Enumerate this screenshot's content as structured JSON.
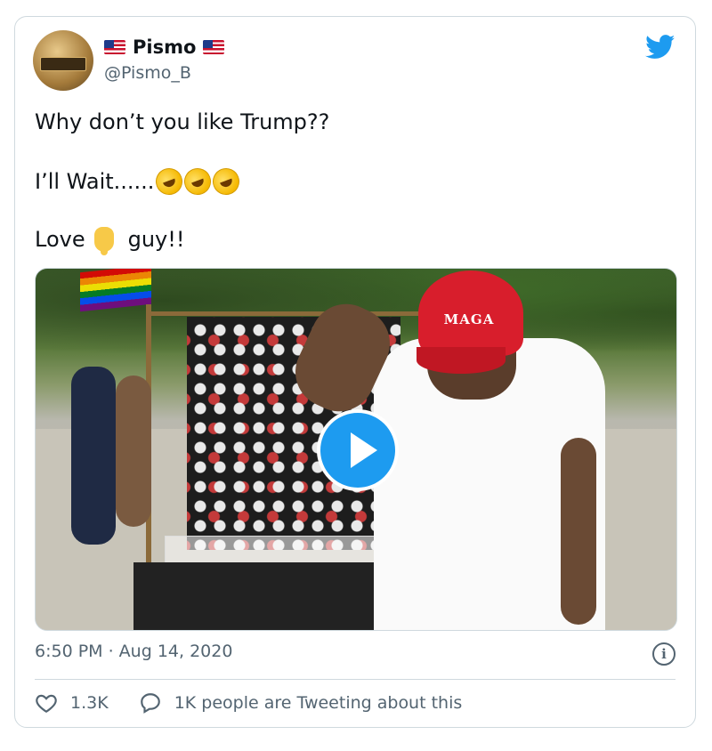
{
  "author": {
    "display_name": "Pismo",
    "handle": "@Pismo_B",
    "avatar_icon": "avatar-trump-plaque",
    "flag_icon": "us-flag-emoji"
  },
  "tweet": {
    "line1": "Why don’t you like Trump??",
    "line2": "I’ll Wait......",
    "line2_emojis": [
      "rolling-on-floor-laughing-emoji",
      "rolling-on-floor-laughing-emoji",
      "rolling-on-floor-laughing-emoji"
    ],
    "line3_start": "Love",
    "line3_emoji": "pointing-down-emoji",
    "line3_end": "guy!!"
  },
  "media": {
    "type": "video",
    "hat_text": "MAGA",
    "play_icon": "play-icon"
  },
  "meta": {
    "timestamp": "6:50 PM · Aug 14, 2020",
    "info_icon": "info-icon"
  },
  "actions": {
    "likes": "1.3K",
    "tweeting": "1K people are Tweeting about this"
  },
  "colors": {
    "twitter_blue": "#1d9bf0",
    "secondary_text": "#536471",
    "border": "#cfd9de"
  }
}
